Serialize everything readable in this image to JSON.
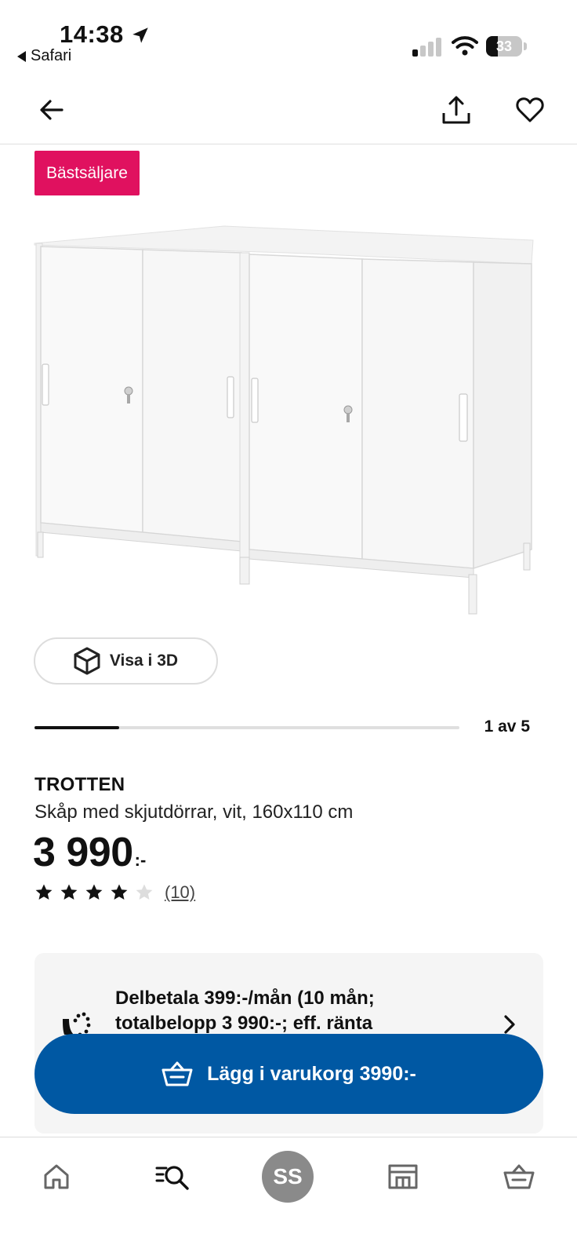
{
  "status_bar": {
    "time": "14:38",
    "back_app": "Safari",
    "battery": "33",
    "battery_level": 0.33
  },
  "badge": "Bästsäljare",
  "view3d_label": "Visa i 3D",
  "gallery": {
    "page_label": "1 av 5",
    "current": 1,
    "total": 5
  },
  "product": {
    "name": "TROTTEN",
    "description": "Skåp med skjutdörrar, vit, 160x110 cm",
    "price": "3 990",
    "price_suffix": ":-",
    "rating": 4,
    "rating_max": 5,
    "review_count": "(10)"
  },
  "installment": {
    "text": "Delbetala 399:-/mån (10 mån; totalbelopp 3 990:-; eff. ränta"
  },
  "cart_button": "Lägg i varukorg 3990:-",
  "tab_bar": {
    "profile_initials": "SS"
  },
  "colors": {
    "badge": "#e0115f",
    "primary": "#0058a3"
  }
}
